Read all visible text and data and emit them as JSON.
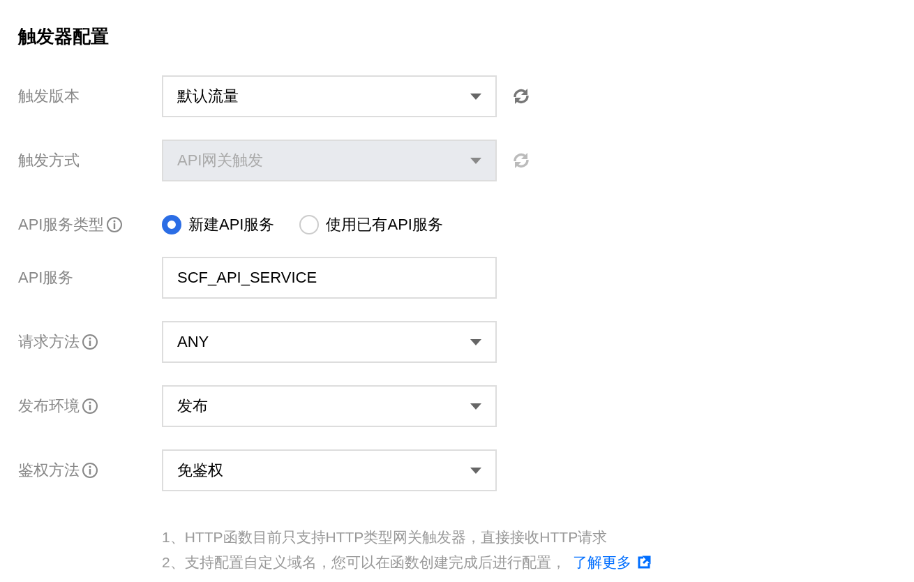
{
  "title": "触发器配置",
  "fields": [
    {
      "label": "触发版本",
      "info": false,
      "kind": "select",
      "value": "默认流量",
      "disabled": false,
      "refresh": true
    },
    {
      "label": "触发方式",
      "info": false,
      "kind": "select",
      "value": "API网关触发",
      "disabled": true,
      "refresh": true
    },
    {
      "label": "API服务类型",
      "info": true,
      "kind": "radio",
      "options": [
        {
          "label": "新建API服务",
          "selected": true
        },
        {
          "label": "使用已有API服务",
          "selected": false
        }
      ]
    },
    {
      "label": "API服务",
      "info": false,
      "kind": "input",
      "value": "SCF_API_SERVICE"
    },
    {
      "label": "请求方法",
      "info": true,
      "kind": "select",
      "value": "ANY",
      "disabled": false,
      "refresh": false
    },
    {
      "label": "发布环境",
      "info": true,
      "kind": "select",
      "value": "发布",
      "disabled": false,
      "refresh": false
    },
    {
      "label": "鉴权方法",
      "info": true,
      "kind": "select",
      "value": "免鉴权",
      "disabled": false,
      "refresh": false
    }
  ],
  "notes": [
    {
      "text": "1、HTTP函数目前只支持HTTP类型网关触发器，直接接收HTTP请求"
    },
    {
      "text": "2、支持配置自定义域名，您可以在函数创建完成后进行配置，",
      "link": "了解更多"
    }
  ]
}
